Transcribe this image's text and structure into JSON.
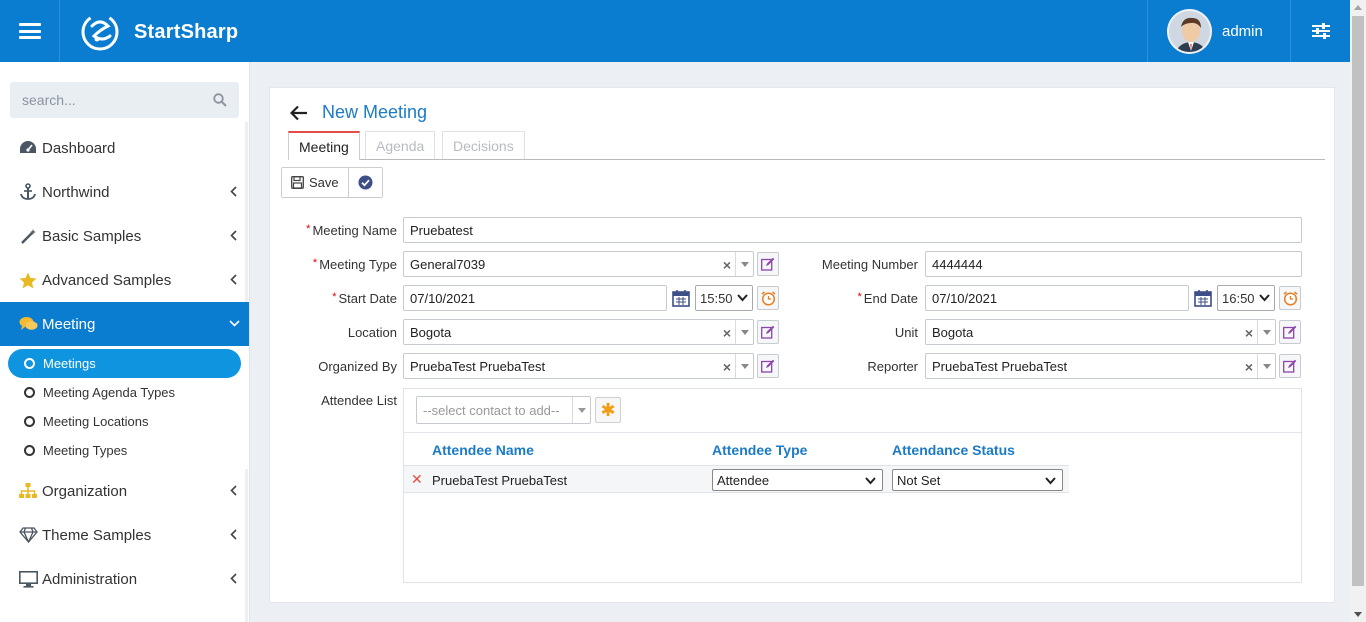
{
  "header": {
    "brand": "StartSharp",
    "user": "admin"
  },
  "sidebar": {
    "search_placeholder": "search...",
    "items": [
      {
        "label": "Dashboard",
        "icon": "dashboard-icon"
      },
      {
        "label": "Northwind",
        "icon": "anchor-icon"
      },
      {
        "label": "Basic Samples",
        "icon": "magic-wand-icon"
      },
      {
        "label": "Advanced Samples",
        "icon": "star-icon"
      },
      {
        "label": "Meeting",
        "icon": "comments-icon"
      },
      {
        "label": "Organization",
        "icon": "sitemap-icon"
      },
      {
        "label": "Theme Samples",
        "icon": "diamond-icon"
      },
      {
        "label": "Administration",
        "icon": "desktop-icon"
      }
    ],
    "meeting_sub": [
      "Meetings",
      "Meeting Agenda Types",
      "Meeting Locations",
      "Meeting Types"
    ]
  },
  "page": {
    "title": "New Meeting",
    "tabs": [
      "Meeting",
      "Agenda",
      "Decisions"
    ],
    "toolbar": {
      "save": "Save"
    }
  },
  "form": {
    "meeting_name": {
      "label": "Meeting Name",
      "value": "Pruebatest"
    },
    "meeting_type": {
      "label": "Meeting Type",
      "value": "General7039"
    },
    "meeting_number": {
      "label": "Meeting Number",
      "value": "4444444"
    },
    "start_date": {
      "label": "Start Date",
      "value": "07/10/2021",
      "time": "15:50"
    },
    "end_date": {
      "label": "End Date",
      "value": "07/10/2021",
      "time": "16:50"
    },
    "location": {
      "label": "Location",
      "value": "Bogota"
    },
    "unit": {
      "label": "Unit",
      "value": "Bogota"
    },
    "organized_by": {
      "label": "Organized By",
      "value": "PruebaTest PruebaTest"
    },
    "reporter": {
      "label": "Reporter",
      "value": "PruebaTest PruebaTest"
    },
    "attendee_list": {
      "label": "Attendee List"
    }
  },
  "attendees": {
    "contact_placeholder": "--select contact to add--",
    "columns": [
      "Attendee Name",
      "Attendee Type",
      "Attendance Status"
    ],
    "rows": [
      {
        "name": "PruebaTest PruebaTest",
        "type": "Attendee",
        "status": "Not Set"
      }
    ]
  },
  "colors": {
    "brand_blue": "#0b7dd1",
    "title_blue": "#1b7bc6",
    "active_sub": "#0f95df",
    "required": "#dd0000"
  }
}
